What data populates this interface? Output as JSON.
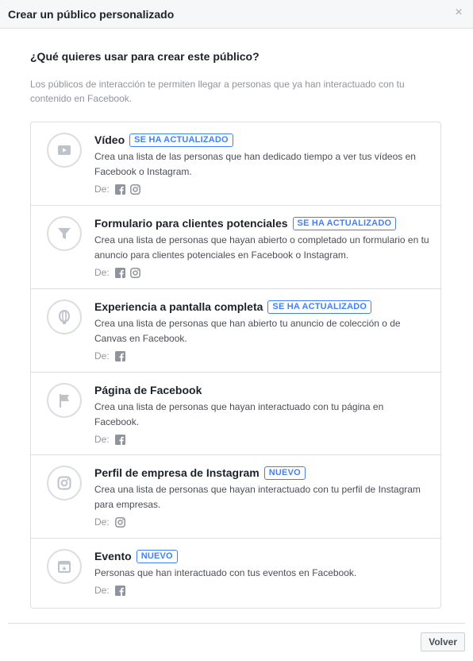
{
  "header": {
    "title": "Crear un público personalizado",
    "close": "×"
  },
  "question": "¿Qué quieres usar para crear este público?",
  "intro": "Los públicos de interacción te permiten llegar a personas que ya han interactuado con tu contenido en Facebook.",
  "source_label": "De:",
  "items": [
    {
      "title": "Vídeo",
      "badge": "SE HA ACTUALIZADO",
      "desc": "Crea una lista de las personas que han dedicado tiempo a ver tus vídeos en Facebook o Instagram.",
      "icon": "video-icon",
      "sources": [
        "facebook-icon",
        "instagram-icon"
      ]
    },
    {
      "title": "Formulario para clientes potenciales",
      "badge": "SE HA ACTUALIZADO",
      "desc": "Crea una lista de personas que hayan abierto o completado un formulario en tu anuncio para clientes potenciales en Facebook o Instagram.",
      "icon": "funnel-icon",
      "sources": [
        "facebook-icon",
        "instagram-icon"
      ]
    },
    {
      "title": "Experiencia a pantalla completa",
      "badge": "SE HA ACTUALIZADO",
      "desc": "Crea una lista de personas que han abierto tu anuncio de colección o de Canvas en Facebook.",
      "icon": "canvas-icon",
      "sources": [
        "facebook-icon"
      ]
    },
    {
      "title": "Página de Facebook",
      "badge": "",
      "desc": "Crea una lista de personas que hayan interactuado con tu página en Facebook.",
      "icon": "flag-icon",
      "sources": [
        "facebook-icon"
      ]
    },
    {
      "title": "Perfil de empresa de Instagram",
      "badge": "NUEVO",
      "desc": "Crea una lista de personas que hayan interactuado con tu perfil de Instagram para empresas.",
      "icon": "instagram-icon",
      "sources": [
        "instagram-icon"
      ]
    },
    {
      "title": "Evento",
      "badge": "NUEVO",
      "desc": "Personas que han interactuado con tus eventos en Facebook.",
      "icon": "calendar-icon",
      "sources": [
        "facebook-icon"
      ]
    }
  ],
  "footer": {
    "back_label": "Volver"
  },
  "colors": {
    "accent": "#4080ff",
    "border": "#dddfe2",
    "icon": "#bec2c9"
  }
}
